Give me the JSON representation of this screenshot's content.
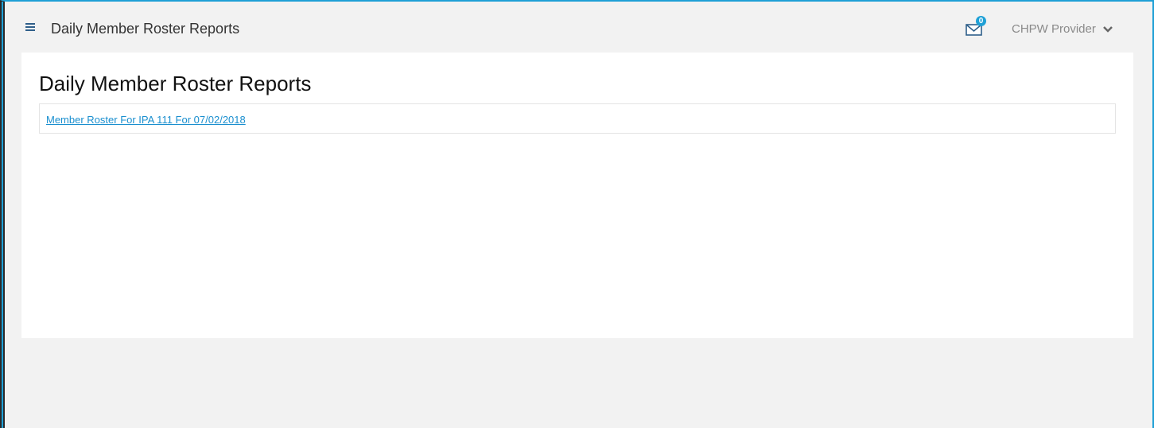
{
  "header": {
    "title": "Daily Member Roster Reports",
    "mail_count": "0",
    "user_name": "CHPW Provider"
  },
  "main": {
    "title": "Daily Member Roster Reports",
    "reports": [
      {
        "label": "Member Roster For IPA 111 For 07/02/2018"
      }
    ]
  },
  "colors": {
    "accent": "#1ea0d6",
    "link": "#1a8fcf",
    "background": "#f2f2f2",
    "panel": "#ffffff"
  }
}
